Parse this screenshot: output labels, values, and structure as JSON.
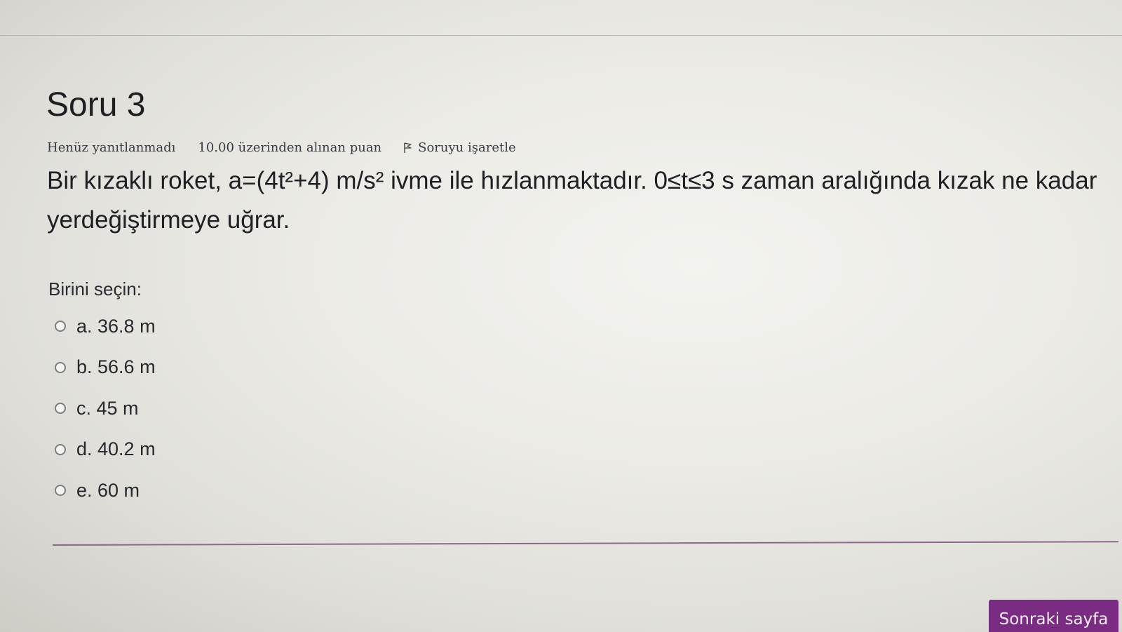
{
  "question": {
    "title": "Soru 3",
    "state": "Henüz yanıtlanmadı",
    "grade": "10.00 üzerinden alınan puan",
    "flag_label": "Soruyu işaretle",
    "flag_icon": "flag-icon",
    "text": "Bir kızaklı roket, a=(4t²+4) m/s² ivme ile hızlanmaktadır. 0≤t≤3 s zaman aralığında kızak ne kadar yerdeğiştirmeye uğrar.",
    "prompt": "Birini seçin:",
    "answers": [
      {
        "label": "a. 36.8 m",
        "selected": false
      },
      {
        "label": "b. 56.6 m",
        "selected": false
      },
      {
        "label": "c. 45 m",
        "selected": false
      },
      {
        "label": "d. 40.2 m",
        "selected": false
      },
      {
        "label": "e. 60 m",
        "selected": false
      }
    ]
  },
  "navigation": {
    "next_label": "Sonraki sayfa"
  },
  "colors": {
    "accent": "#7a2c83",
    "divider": "#8c6b8a",
    "text": "#202024"
  }
}
